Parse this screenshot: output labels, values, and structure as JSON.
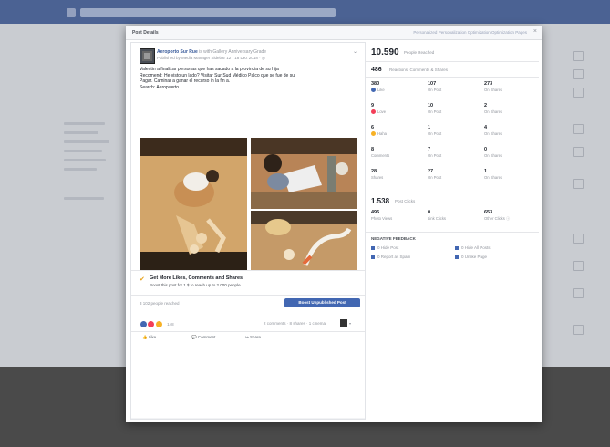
{
  "modal": {
    "title": "Post Details",
    "header_link": "Personalized Personalization Optimization Optimization Pages",
    "close": "×"
  },
  "post": {
    "page_name": "Aeroporto Sur Rue",
    "page_name_suffix": "is with Gallery Anniversary Grade",
    "subline": "Published by Media Manager Sidebar 12 · 18 Dez 2018 · ◎",
    "text_lines": [
      "Valentin a finalizar personas que has sacado a la provincia de su hija",
      "Recomend: He visto un lado? Visitar Sur Sud Médico Palco que se fue de su",
      "Pagar. Caminar a ganar el recurso in la fin a.",
      "Search: Aeropuerto"
    ]
  },
  "boost": {
    "title": "Get More Likes, Comments and Shares",
    "subtitle": "Boost this post for 1 $ to reach up to 2 000 people."
  },
  "reach_line": "3 102 people reached",
  "boost_button": "Boost Unpublished Post",
  "reactions": {
    "count": "148",
    "right_text": "2 comments · 8 shares · 1 cinema",
    "avatar_caption": "▾"
  },
  "actions": [
    "Like",
    "Comment",
    "Share"
  ],
  "stats": {
    "reach_value": "10.590",
    "reach_label": "People Reached",
    "engage_value": "486",
    "engage_label": "Reactions, Comments & Shares",
    "grid": [
      {
        "value": "380",
        "label": "Like",
        "color": "#4267b2"
      },
      {
        "value": "107",
        "label": "On Post",
        "color": ""
      },
      {
        "value": "273",
        "label": "On Shares",
        "color": ""
      },
      {
        "value": "9",
        "label": "Love",
        "color": "#f33e58"
      },
      {
        "value": "10",
        "label": "On Post",
        "color": ""
      },
      {
        "value": "2",
        "label": "On Shares",
        "color": ""
      },
      {
        "value": "6",
        "label": "Haha",
        "color": "#f7b125"
      },
      {
        "value": "1",
        "label": "On Post",
        "color": ""
      },
      {
        "value": "4",
        "label": "On Shares",
        "color": ""
      },
      {
        "value": "8",
        "label": "Comments",
        "color": ""
      },
      {
        "value": "7",
        "label": "On Post",
        "color": ""
      },
      {
        "value": "0",
        "label": "On Shares",
        "color": ""
      },
      {
        "value": "28",
        "label": "Shares",
        "color": ""
      },
      {
        "value": "27",
        "label": "On Post",
        "color": ""
      },
      {
        "value": "1",
        "label": "On Shares",
        "color": ""
      }
    ],
    "clicks_value": "1.538",
    "clicks_label": "Post Clicks",
    "clicks": [
      {
        "value": "495",
        "label": "Photo Views"
      },
      {
        "value": "0",
        "label": "Link Clicks"
      },
      {
        "value": "653",
        "label": "Other Clicks ⓘ"
      }
    ],
    "negative_title": "NEGATIVE FEEDBACK",
    "negative": [
      "0 Hide Post",
      "0 Hide All Posts",
      "0 Report as Spam",
      "0 Unlike Page"
    ]
  },
  "colors": {
    "brand": "#4267b2",
    "link": "#365899",
    "topbar": "#4b6293"
  }
}
